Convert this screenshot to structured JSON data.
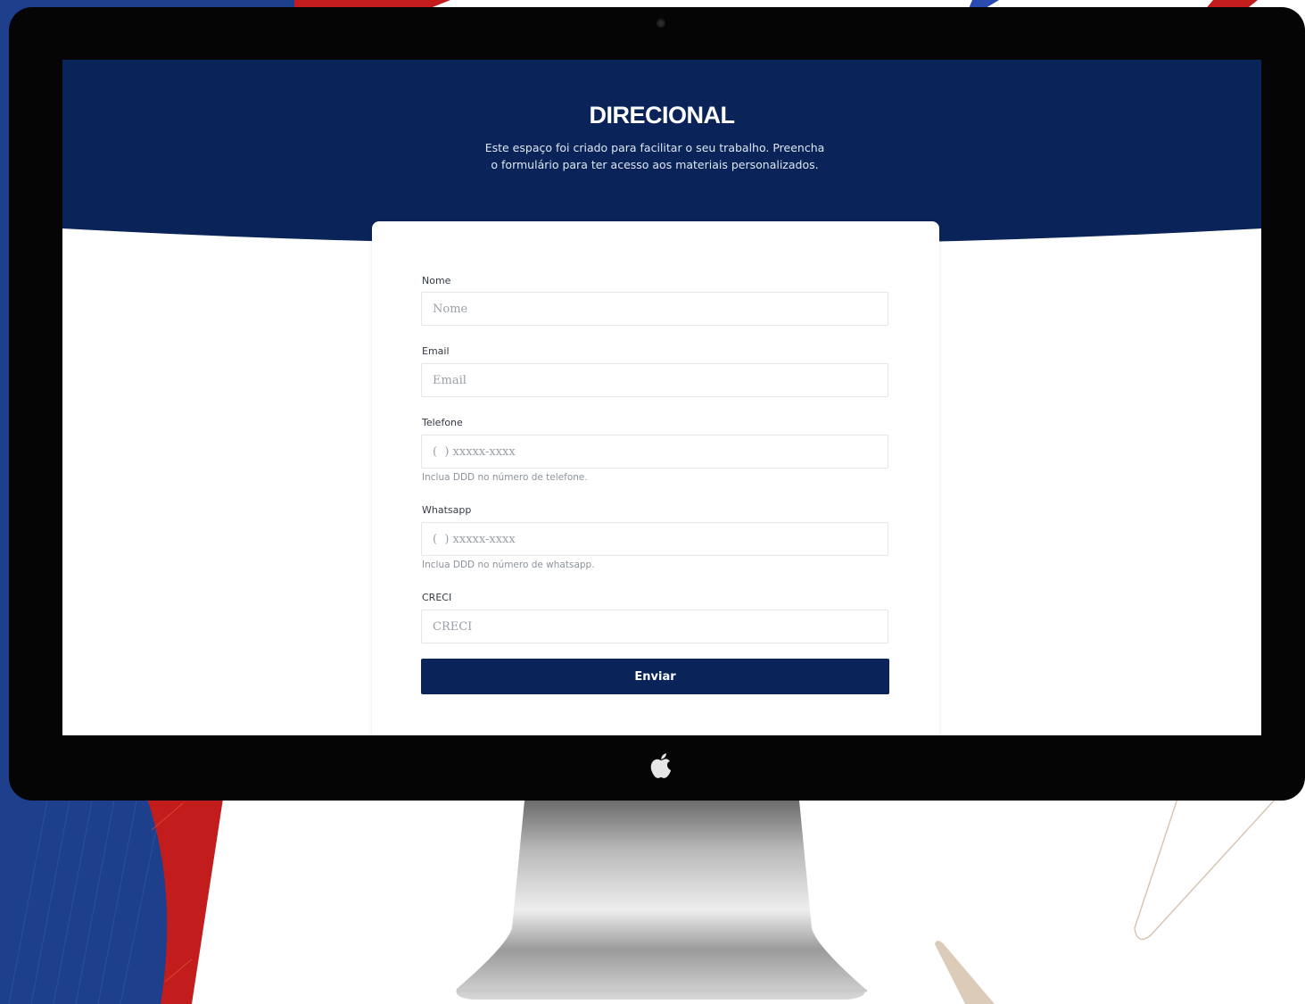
{
  "brand": {
    "logo_text": "DIRECIONAL",
    "primary_color": "#0a2459",
    "accent_color": "#c21c1c"
  },
  "intro": {
    "text": "Este espaço foi criado para facilitar o seu trabalho. Preencha o formulário para ter acesso aos materiais personalizados."
  },
  "form": {
    "fields": [
      {
        "label": "Nome",
        "placeholder": "Nome"
      },
      {
        "label": "Email",
        "placeholder": "Email"
      },
      {
        "label": "Telefone",
        "placeholder": "(  ) xxxxx-xxxx",
        "help": "Inclua DDD no número de telefone."
      },
      {
        "label": "Whatsapp",
        "placeholder": "(  ) xxxxx-xxxx",
        "help": "Inclua DDD no número de whatsapp."
      },
      {
        "label": "CRECI",
        "placeholder": "CRECI"
      }
    ],
    "submit_label": "Enviar"
  },
  "icons": {
    "camera": "camera-icon",
    "apple": "apple-logo-icon"
  }
}
